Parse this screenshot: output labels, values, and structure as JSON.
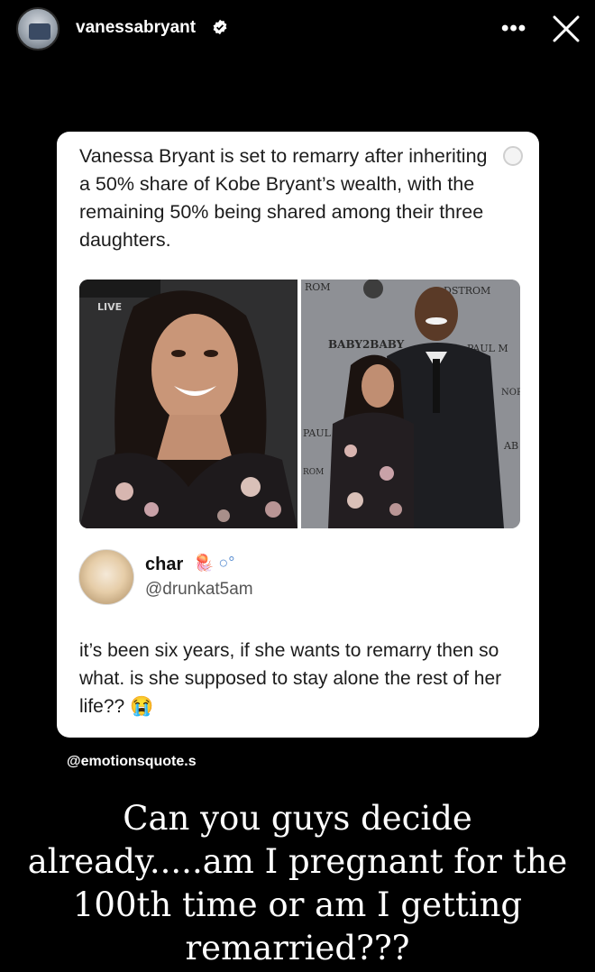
{
  "header": {
    "username": "vanessabryant",
    "verified_icon": "verified-badge-icon",
    "more_label": "•••",
    "close_icon": "close-icon"
  },
  "post": {
    "headline": "Vanessa Bryant is set to remarry after inheriting a 50% share of Kobe Bryant’s wealth, with the remaining 50% being shared among their three daughters.",
    "images": [
      {
        "name": "photo-vanessa",
        "signage": "LIVE"
      },
      {
        "name": "photo-vanessa-kobe",
        "signage": [
          "ROM",
          "DSTROM",
          "BABY2BABY",
          "PAUL M",
          "NOR",
          "AB",
          "PAUL",
          "ROM"
        ]
      }
    ],
    "reply": {
      "display_name": "char",
      "badges": "🪼 ○°",
      "handle": "@drunkat5am",
      "text": "it’s been six years, if she wants to remarry then so what. is she supposed to stay alone the rest of her life?? 😭"
    }
  },
  "watermark": "@emotionsquote.s",
  "caption": "Can you guys decide already.....am I pregnant for the 100th time or am I getting remarried???",
  "colors": {
    "background": "#000000",
    "card": "#ffffff",
    "text": "#1c1c1c",
    "handle": "#555555",
    "verified": "#3897f0"
  }
}
